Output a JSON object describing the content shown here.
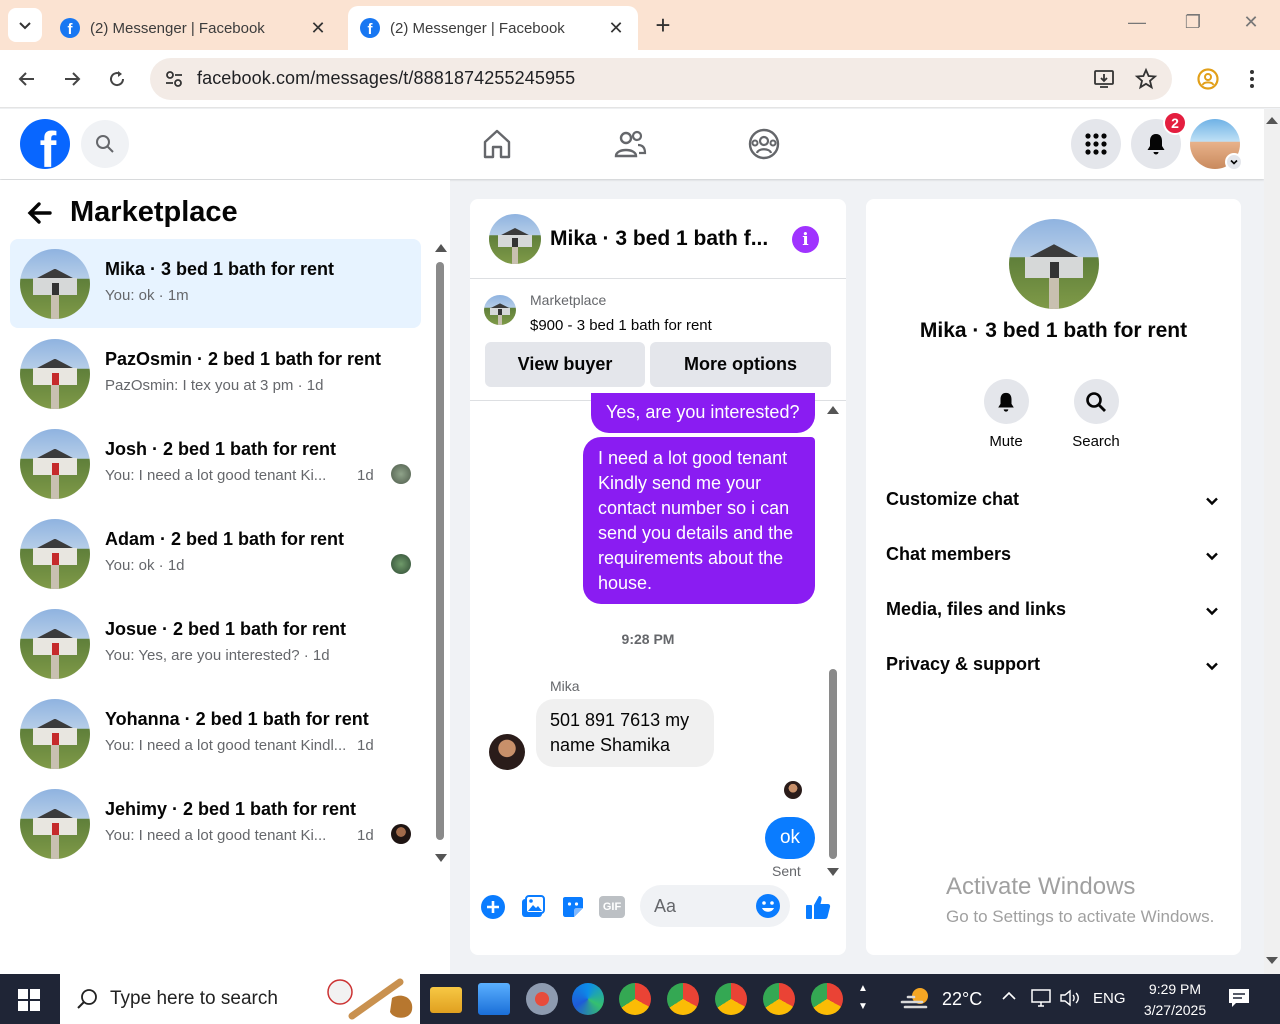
{
  "browser": {
    "tabs": [
      {
        "title": "(2) Messenger | Facebook"
      },
      {
        "title": "(2) Messenger | Facebook"
      }
    ],
    "url": "facebook.com/messages/t/8881874255245955"
  },
  "fb_nav": {
    "notification_count": "2"
  },
  "sidebar": {
    "title": "Marketplace",
    "conversations": [
      {
        "name": "Mika · 3 bed 1 bath for rent",
        "preview": "You: ok · 1m",
        "time": "",
        "active": true
      },
      {
        "name": "PazOsmin · 2 bed 1 bath for rent",
        "preview": "PazOsmin: I tex you at 3 pm · 1d",
        "time": ""
      },
      {
        "name": "Josh · 2 bed 1 bath for rent",
        "preview": "You: I need a lot good tenant Ki...",
        "time": "1d"
      },
      {
        "name": "Adam · 2 bed 1 bath for rent",
        "preview": "You: ok · 1d",
        "time": ""
      },
      {
        "name": "Josue · 2 bed 1 bath for rent",
        "preview": "You: Yes, are you interested? · 1d",
        "time": ""
      },
      {
        "name": "Yohanna · 2 bed 1 bath for rent",
        "preview": "You: I need a lot good tenant Kindl...",
        "time": "1d"
      },
      {
        "name": "Jehimy · 2 bed 1 bath for rent",
        "preview": "You: I need a lot good tenant Ki...",
        "time": "1d"
      }
    ]
  },
  "chat": {
    "title": "Mika · 3 bed 1 bath f...",
    "marketplace_label": "Marketplace",
    "listing": "$900 - 3 bed 1 bath for rent",
    "view_buyer": "View buyer",
    "more_options": "More options",
    "messages": {
      "out1": "Yes, are you interested?",
      "out2": "I need a lot good tenant Kindly send me your contact number so i can send you details and the requirements about the house.",
      "timestamp": "9:28 PM",
      "sender": "Mika",
      "in1": "501 891 7613 my name Shamika",
      "out3": "ok",
      "status": "Sent"
    },
    "composer_placeholder": "Aa"
  },
  "info_panel": {
    "name": "Mika · 3 bed 1 bath for rent",
    "actions": [
      {
        "label": "Mute",
        "icon": "bell-icon"
      },
      {
        "label": "Search",
        "icon": "search-icon"
      }
    ],
    "sections": [
      "Customize chat",
      "Chat members",
      "Media, files and links",
      "Privacy & support"
    ]
  },
  "watermark": {
    "line1": "Activate Windows",
    "line2": "Go to Settings to activate Windows."
  },
  "taskbar": {
    "search_placeholder": "Type here to search",
    "temperature": "22°C",
    "language": "ENG",
    "time": "9:29 PM",
    "date": "3/27/2025"
  },
  "colors": {
    "fb_blue": "#0866ff",
    "outgoing_bubble": "#8a1cf2",
    "ok_bubble": "#0a7cff",
    "badge_red": "#e41e3f"
  }
}
